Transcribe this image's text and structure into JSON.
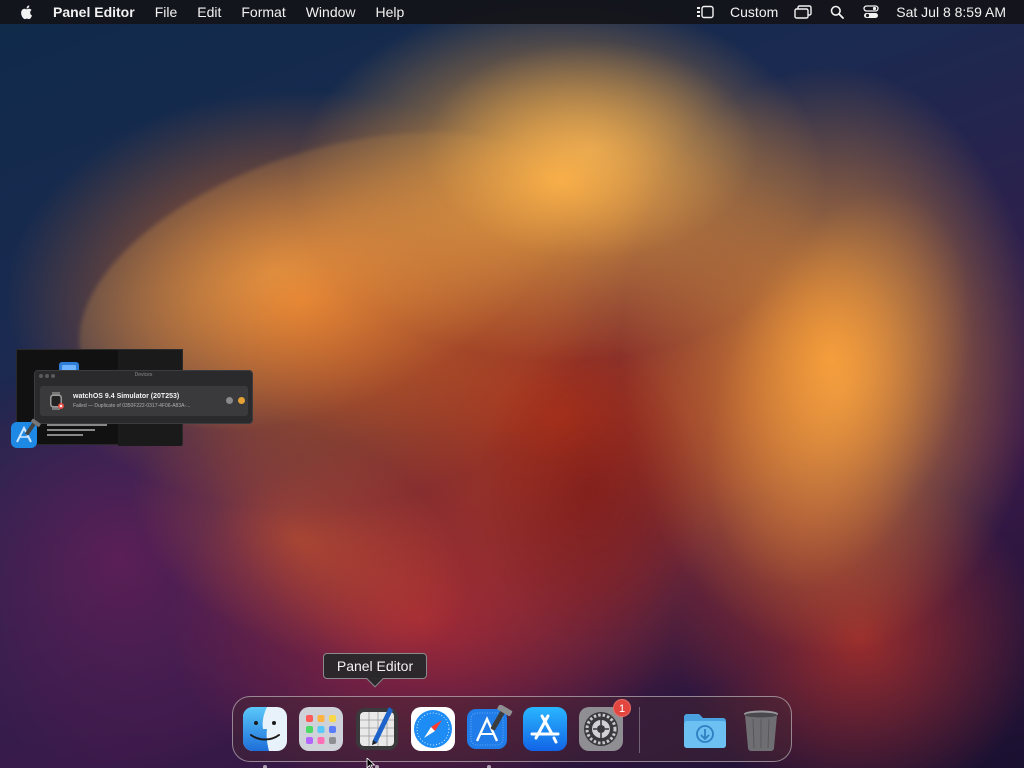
{
  "menubar": {
    "app_name": "Panel Editor",
    "menus": [
      "File",
      "Edit",
      "Format",
      "Window",
      "Help"
    ],
    "custom_label": "Custom",
    "clock": "Sat Jul 8  8:59 AM"
  },
  "stage_manager": {
    "window_title": "Devices",
    "simulator_title": "watchOS 9.4 Simulator (20T253)",
    "simulator_subtitle": "Failed — Duplicate of 0350F222-0317-4F06-A83A-..."
  },
  "dock": {
    "tooltip": "Panel Editor",
    "items": [
      {
        "name": "Finder",
        "icon": "finder-icon",
        "running": true
      },
      {
        "name": "Launchpad",
        "icon": "launchpad-icon",
        "running": false
      },
      {
        "name": "Panel Editor",
        "icon": "panel-editor-icon",
        "running": true
      },
      {
        "name": "Safari",
        "icon": "safari-icon",
        "running": false
      },
      {
        "name": "Xcode",
        "icon": "xcode-icon",
        "running": true
      },
      {
        "name": "App Store",
        "icon": "app-store-icon",
        "running": false
      },
      {
        "name": "System Settings",
        "icon": "system-settings-icon",
        "running": false,
        "badge": "1"
      },
      {
        "name": "Downloads",
        "icon": "downloads-folder-icon",
        "running": false
      },
      {
        "name": "Trash",
        "icon": "trash-icon",
        "running": false
      }
    ]
  },
  "colors": {
    "menubar_bg": "#141418",
    "badge": "#e2463f",
    "accent_blue": "#1e88e5"
  }
}
